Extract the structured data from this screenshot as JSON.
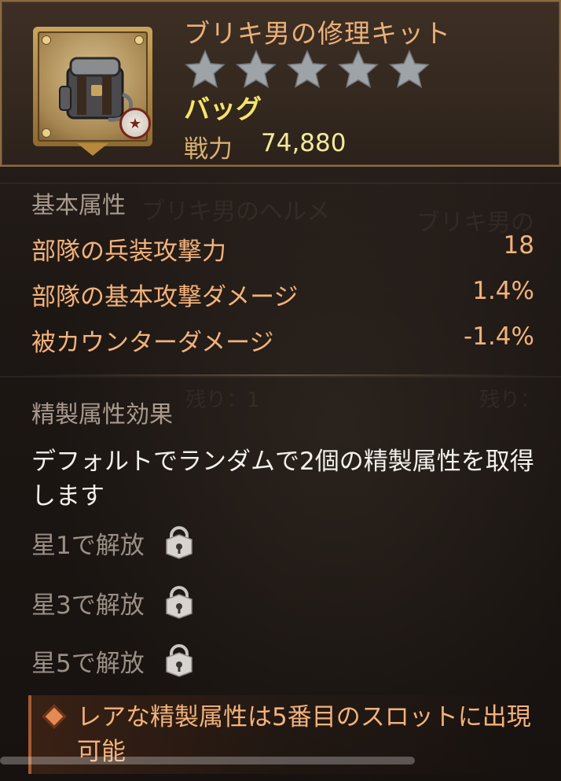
{
  "item": {
    "name": "ブリキ男の修理キット",
    "stars_total": 5,
    "stars_filled": 0,
    "type": "バッグ",
    "power_label": "戦力",
    "power_value": "74,880",
    "icon": "backpack-icon",
    "badge_icon": "star-badge-icon"
  },
  "basic": {
    "title": "基本属性",
    "stats": [
      {
        "label": "部隊の兵装攻撃力",
        "value": "18"
      },
      {
        "label": "部隊の基本攻撃ダメージ",
        "value": "1.4%"
      },
      {
        "label": "被カウンターダメージ",
        "value": "-1.4%"
      }
    ]
  },
  "refine": {
    "title": "精製属性効果",
    "description": "デフォルトでランダムで2個の精製属性を取得します",
    "unlocks": [
      {
        "label": "星1で解放",
        "icon": "lock-icon"
      },
      {
        "label": "星3で解放",
        "icon": "lock-icon"
      },
      {
        "label": "星5で解放",
        "icon": "lock-icon"
      }
    ]
  },
  "note": {
    "icon": "diamond-icon",
    "text": "レアな精製属性は5番目のスロットに出現可能"
  },
  "background_hints": [
    "ブリキ男のヘルメ",
    "ブリキ男の",
    "残り：1",
    "残り："
  ],
  "colors": {
    "accent": "#f3b27a",
    "title": "#e9b07a",
    "type": "#f6e46a",
    "power": "#f2ea9a",
    "muted": "#a99a8e",
    "frame": "#8a6a43"
  }
}
